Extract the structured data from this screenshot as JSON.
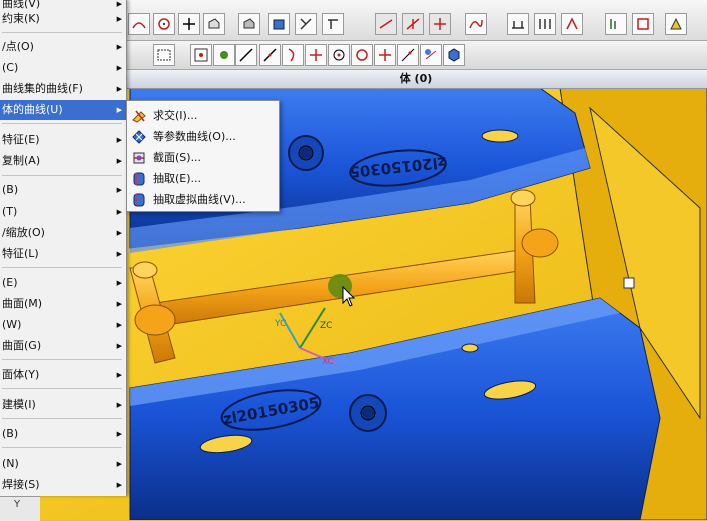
{
  "menu": {
    "items": [
      {
        "label": "曲线(V)"
      },
      {
        "label": "约束(K)"
      },
      {
        "label": "/点(O)"
      },
      {
        "label": "(C)"
      },
      {
        "label": "曲线集的曲线(F)"
      },
      {
        "label": "体的曲线(U)",
        "selected": true
      },
      {
        "label": "特征(E)"
      },
      {
        "label": "复制(A)"
      },
      {
        "label": "(B)"
      },
      {
        "label": "(T)"
      },
      {
        "label": "/缩放(O)"
      },
      {
        "label": "特征(L)"
      },
      {
        "label": "(E)"
      },
      {
        "label": "曲面(M)"
      },
      {
        "label": "(W)"
      },
      {
        "label": "曲面(G)"
      },
      {
        "label": "面体(Y)"
      },
      {
        "label": "建模(I)"
      },
      {
        "label": "(B)"
      },
      {
        "label": "(N)"
      },
      {
        "label": "焊接(S)"
      }
    ]
  },
  "submenu": {
    "items": [
      {
        "label": "求交(I)...",
        "icon": "intersect-icon"
      },
      {
        "label": "等参数曲线(O)...",
        "icon": "isoparametric-icon"
      },
      {
        "label": "截面(S)...",
        "icon": "section-icon"
      },
      {
        "label": "抽取(E)...",
        "icon": "extract-icon"
      },
      {
        "label": "抽取虚拟曲线(V)...",
        "icon": "extract-virtual-icon"
      }
    ]
  },
  "titlebar": {
    "text": "体 (0)"
  },
  "viewport": {
    "engrave_text_1": "zl20150305",
    "engrave_text_2": "zl20150305",
    "axis_yc": "YC",
    "axis_zc": "ZC",
    "axis_xc": "XC",
    "axis_y_corner": "Y"
  },
  "colors": {
    "part_blue": "#1a55d8",
    "mold_yellow": "#f2c21a",
    "runner_orange": "#f5a318",
    "menu_highlight": "#3a6fd0"
  }
}
